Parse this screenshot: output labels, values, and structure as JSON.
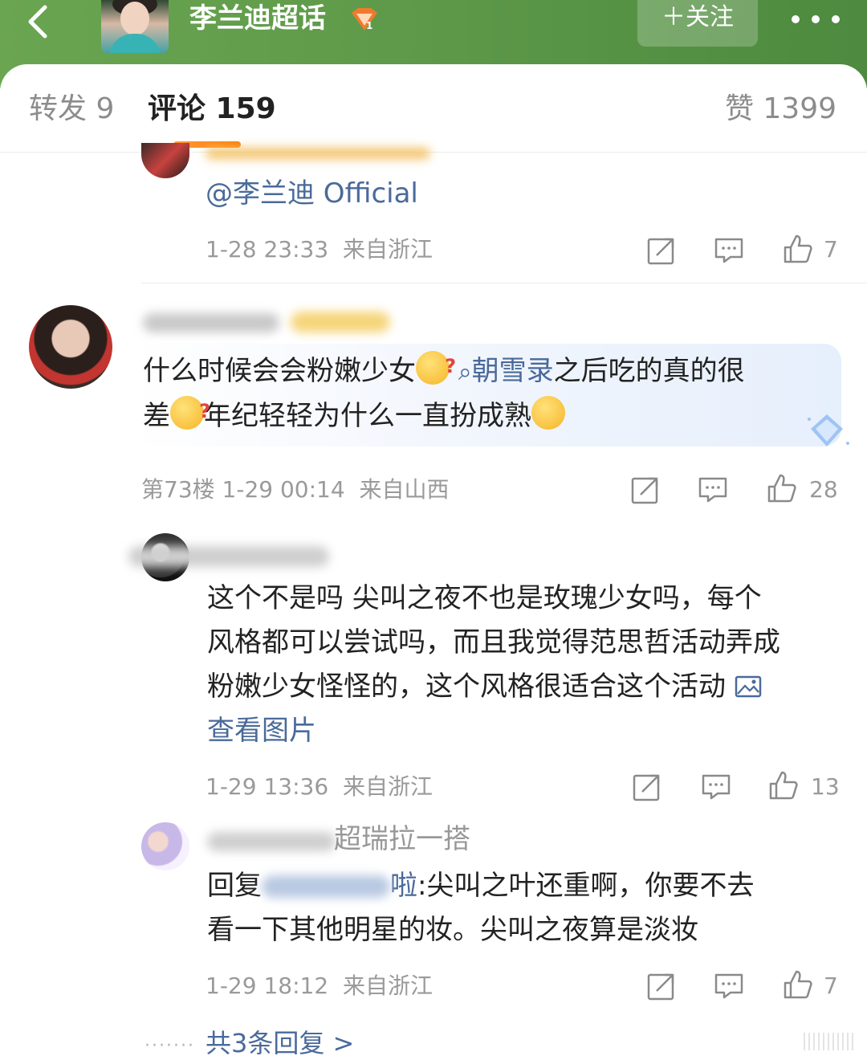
{
  "header": {
    "title": "李兰迪超话",
    "follow_label": "＋关注",
    "back_icon": "chevron-left-icon",
    "more_icon": "ellipsis-icon",
    "badge_icon": "super-topic-badge-icon"
  },
  "tabs": {
    "forward": "转发 9",
    "comments": "评论 159",
    "likes": "赞 1399"
  },
  "comments": [
    {
      "text": "@李兰迪 Official",
      "time": "1-28 23:33",
      "location": "来自浙江",
      "likes": "7"
    },
    {
      "line1_part1": "什么时候会会粉嫩少女",
      "topic": "朝雪录",
      "line1_part2": "之后吃的真的很",
      "line2_part1": "差",
      "line2_part2": "年纪轻轻为什么一直扮成熟",
      "floor": "第73楼",
      "time": "1-29 00:14",
      "location": "来自山西",
      "likes": "28"
    },
    {
      "line1": "这个不是吗 尖叫之夜不也是玫瑰少女吗，每个",
      "line2": "风格都可以尝试吗，而且我觉得范思哲活动弄成",
      "line3": "粉嫩少女怪怪的，这个风格很适合这个活动",
      "image_link": "查看图片",
      "time": "1-29 13:36",
      "location": "来自浙江",
      "likes": "13"
    },
    {
      "name_partial": "超瑞拉一搭",
      "reply_prefix": "回复",
      "reply_target_partial": "啦",
      "line1": ":尖叫之叶还重啊，你要不去",
      "line2": "看一下其他明星的妆。尖叫之夜算是淡妆",
      "time": "1-29 18:12",
      "location": "来自浙江",
      "likes": "7"
    }
  ],
  "more_replies": "共3条回复 >",
  "colors": {
    "header_green": "#5e9a49",
    "accent_orange": "#ff7a00",
    "link_blue": "#4a6a9a",
    "meta_gray": "#9a9a9a"
  }
}
